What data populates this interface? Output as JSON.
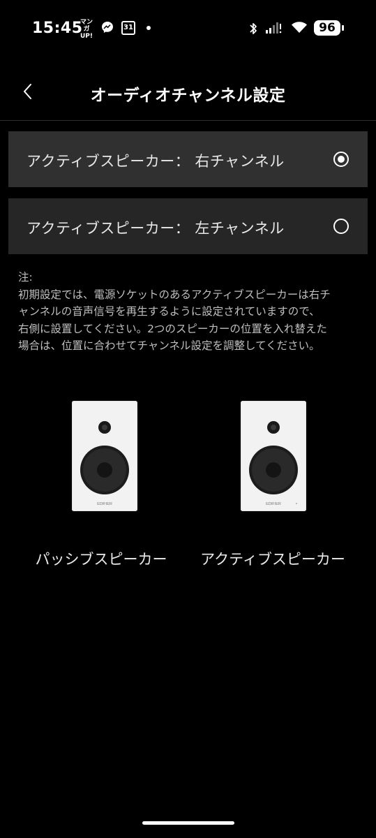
{
  "status_bar": {
    "time": "15:45",
    "manga_app_label": "マンガUP!",
    "calendar_day": "31",
    "battery": "96"
  },
  "header": {
    "title": "オーディオチャンネル設定"
  },
  "options": [
    {
      "label": "アクティブスピーカー： 右チャンネル",
      "selected": true
    },
    {
      "label": "アクティブスピーカー： 左チャンネル",
      "selected": false
    }
  ],
  "note": {
    "lines": [
      "注:",
      "初期設定では、電源ソケットのあるアクティブスピーカーは右チ",
      "ャンネルの音声信号を再生するように設定されていますので、",
      "右側に設置してください。2つのスピーカーの位置を入れ替えた",
      "場合は、位置に合わせてチャンネル設定を調整してください。"
    ]
  },
  "speakers": {
    "left_label": "パッシブスピーカー",
    "right_label": "アクティブスピーカー",
    "brand_text": "EDIFIER"
  },
  "colors": {
    "background": "#000000",
    "option_selected": "#303030",
    "option_unselected": "#262626",
    "speaker_body": "#f2f2f2"
  }
}
